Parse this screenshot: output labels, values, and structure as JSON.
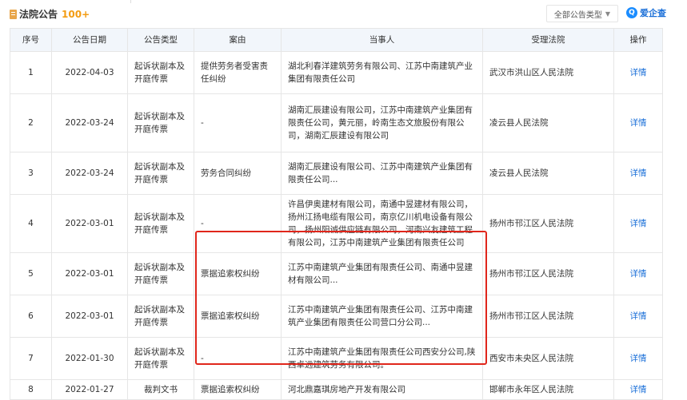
{
  "header": {
    "title": "法院公告",
    "count": "100+",
    "type_filter": "全部公告类型",
    "brand": "爱企查",
    "brand_icon": "q-logo-icon"
  },
  "columns": [
    "序号",
    "公告日期",
    "公告类型",
    "案由",
    "当事人",
    "受理法院",
    "操作"
  ],
  "rows": [
    {
      "no": "1",
      "date": "2022-04-03",
      "type": "起诉状副本及开庭传票",
      "cause": "提供劳务者受害责任纠纷",
      "parties": "湖北利春洋建筑劳务有限公司、江苏中南建筑产业集团有限责任公司",
      "court": "武汉市洪山区人民法院",
      "action": "详情"
    },
    {
      "no": "2",
      "date": "2022-03-24",
      "type": "起诉状副本及开庭传票",
      "cause": "-",
      "parties": "湖南汇辰建设有限公司，江苏中南建筑产业集团有限责任公司，黄元丽，岭南生态文旅股份有限公司，湖南汇辰建设有限公司",
      "court": "凌云县人民法院",
      "action": "详情"
    },
    {
      "no": "3",
      "date": "2022-03-24",
      "type": "起诉状副本及开庭传票",
      "cause": "劳务合同纠纷",
      "parties": "湖南汇辰建设有限公司、江苏中南建筑产业集团有限责任公司...",
      "court": "凌云县人民法院",
      "action": "详情"
    },
    {
      "no": "4",
      "date": "2022-03-01",
      "type": "起诉状副本及开庭传票",
      "cause": "-",
      "parties": "许昌伊奥建材有限公司，南通中昱建材有限公司，扬州江扬电缆有限公司，南京亿川机电设备有限公司，扬州阳诚供应链有限公司，河南兴友建筑工程有限公司，江苏中南建筑产业集团有限责任公司",
      "court": "扬州市邗江区人民法院",
      "action": "详情"
    },
    {
      "no": "5",
      "date": "2022-03-01",
      "type": "起诉状副本及开庭传票",
      "cause": "票据追索权纠纷",
      "parties": "江苏中南建筑产业集团有限责任公司、南通中昱建材有限公司...",
      "court": "扬州市邗江区人民法院",
      "action": "详情"
    },
    {
      "no": "6",
      "date": "2022-03-01",
      "type": "起诉状副本及开庭传票",
      "cause": "票据追索权纠纷",
      "parties": "江苏中南建筑产业集团有限责任公司、江苏中南建筑产业集团有限责任公司营口分公司...",
      "court": "扬州市邗江区人民法院",
      "action": "详情"
    },
    {
      "no": "7",
      "date": "2022-01-30",
      "type": "起诉状副本及开庭传票",
      "cause": "-",
      "parties": "江苏中南建筑产业集团有限责任公司西安分公司,陕西卓远建筑劳务有限公司。",
      "court": "西安市未央区人民法院",
      "action": "详情"
    },
    {
      "no": "8",
      "date": "2022-01-27",
      "type": "裁判文书",
      "cause": "票据追索权纠纷",
      "parties": "河北鼎嘉琪房地产开发有限公司",
      "court": "邯郸市永年区人民法院",
      "action": "详情"
    }
  ],
  "colors": {
    "accent": "#1a6fd8",
    "count": "#f39c12",
    "highlight": "#e0261b",
    "header_bg": "#f2f6fb"
  }
}
